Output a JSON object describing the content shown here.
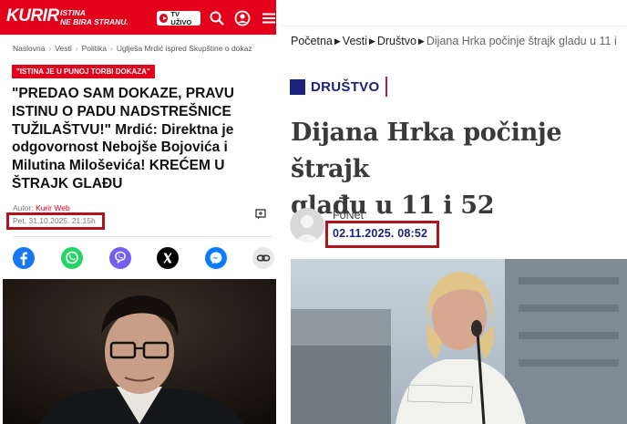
{
  "left": {
    "header": {
      "logo": "KURIR",
      "slogan_line1": "ISTINA",
      "slogan_line2": "NE BIRA STRANU.",
      "tv_label": "TV UŽIVO",
      "icons": [
        "search-icon",
        "user-icon",
        "menu-icon"
      ],
      "brand_color": "#e3001b"
    },
    "breadcrumb": [
      "Naslovna",
      "Vesti",
      "Politika",
      "Uglješa Mrdić ispred Skupštine o dokaz"
    ],
    "tag": "\"ISTINA JE U PUNOJ TORBI DOKAZA\"",
    "headline_line1": "\"PREDAO SAM DOKAZE, PRAVU",
    "headline_line2": "ISTINU O PADU NADSTREŠNICE",
    "headline_line3_a": "TUŽILAŠTVU!\"",
    "headline_line3_b": " Mrdić: Direktna je",
    "headline_line4": "odgovornost Nebojše Bojovića i",
    "headline_line5": "Milutina Miloševića! KREĆEM U",
    "headline_line6": "ŠTRAJK GLAĐU",
    "author_label": "Autor:",
    "author_name": "Kurir Web",
    "date": "Pet, 31.10.2025. 21:15h",
    "share_icons": [
      "facebook-icon",
      "whatsapp-icon",
      "viber-icon",
      "x-icon",
      "messenger-icon",
      "link-icon"
    ]
  },
  "right": {
    "breadcrumb": [
      "Početna",
      "Vesti",
      "Društvo",
      "Dijana Hrka počinje štrajk gladu u 11 i"
    ],
    "section": "DRUŠTVO",
    "title_line1": "Dijana Hrka počinje štrajk",
    "title_line2": "glađu u 11 i 52",
    "author": "FoNet",
    "date": "02.11.2025. 08:52",
    "accent_color": "#1a237e",
    "highlight_color": "#b0131d"
  }
}
